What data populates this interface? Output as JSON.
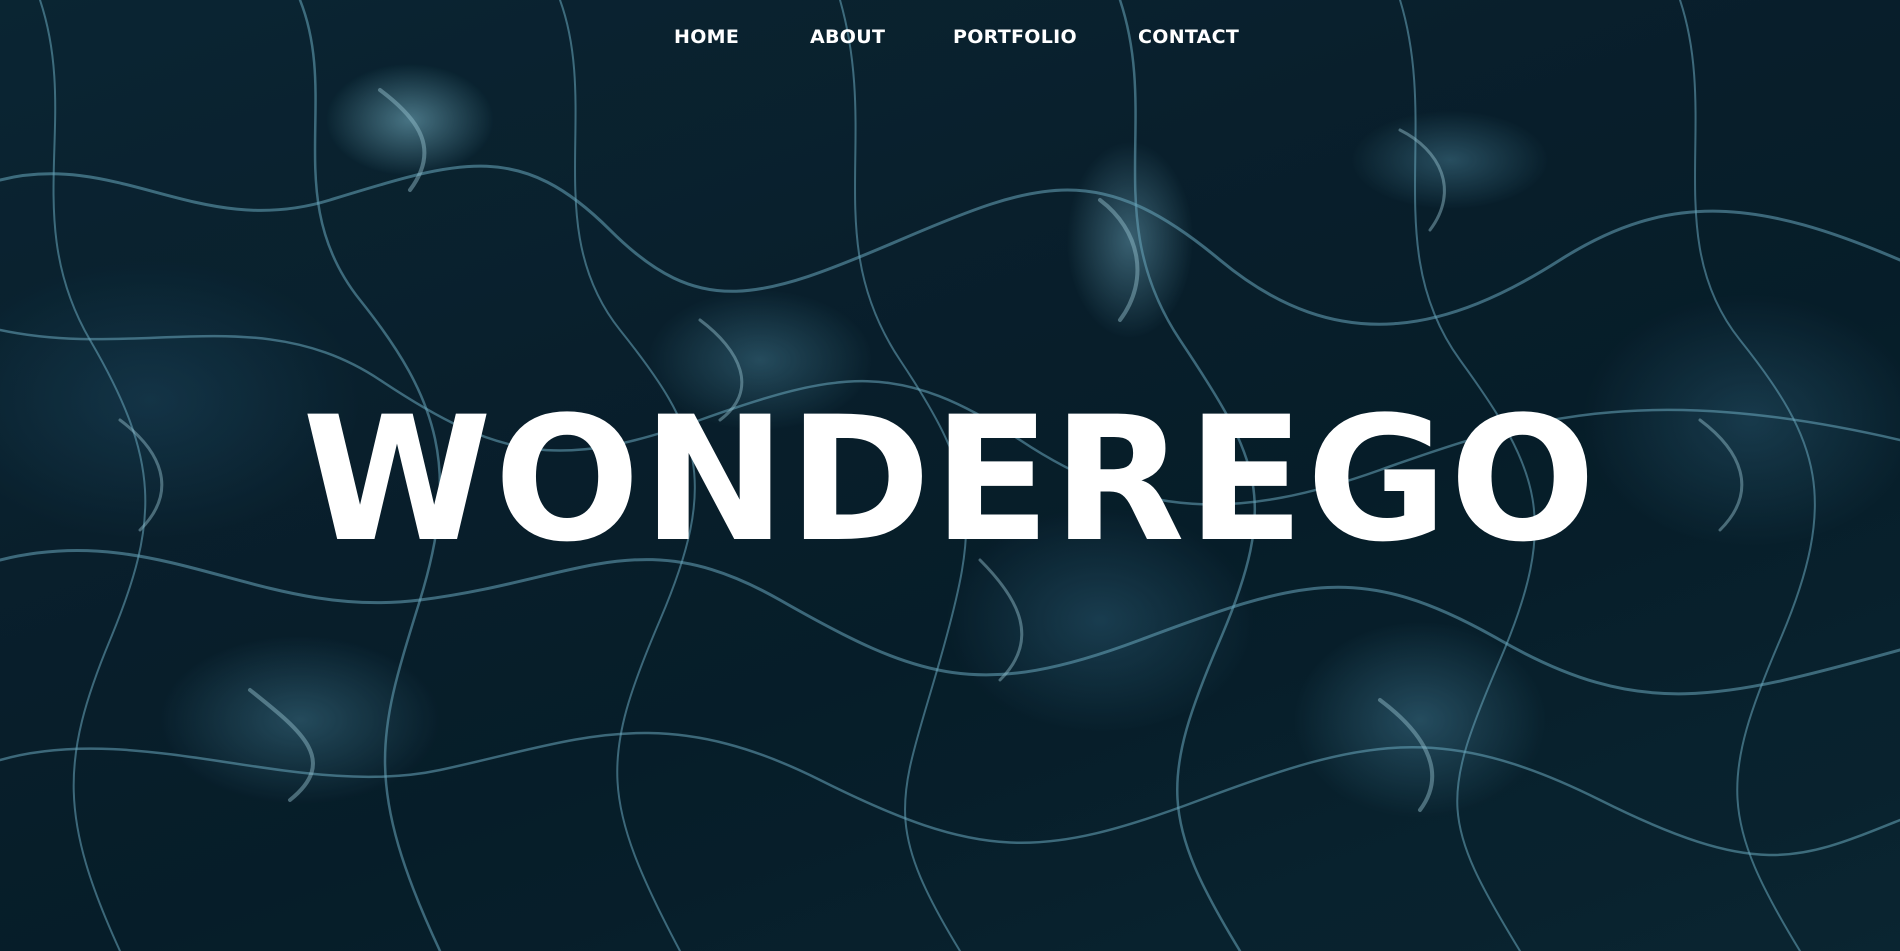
{
  "nav": {
    "items": [
      {
        "label": "HOME"
      },
      {
        "label": "ABOUT"
      },
      {
        "label": "PORTFOLIO"
      },
      {
        "label": "CONTACT"
      }
    ]
  },
  "hero": {
    "title": "WONDEREGO",
    "background": "underwater-caustics-image"
  },
  "colors": {
    "text": "#ffffff",
    "background": "#0a2330",
    "highlight": "#8fd3ea"
  }
}
